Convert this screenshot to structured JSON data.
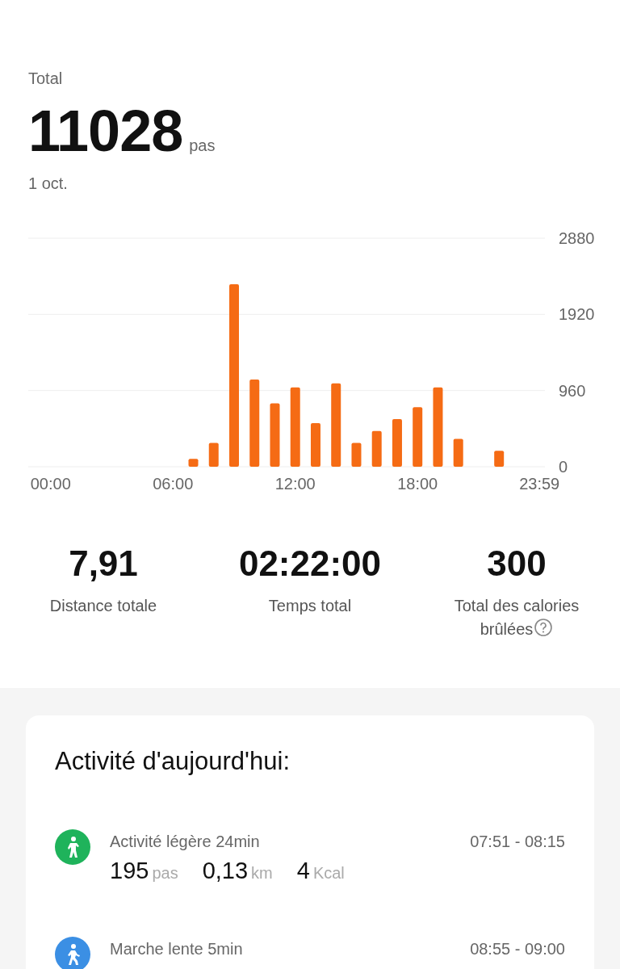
{
  "summary": {
    "label": "Total",
    "steps": "11028",
    "unit": "pas",
    "date": "1 oct."
  },
  "chart_data": {
    "type": "bar",
    "x": [
      7,
      8,
      9,
      10,
      11,
      12,
      13,
      14,
      15,
      16,
      17,
      18,
      19,
      20,
      22
    ],
    "series": [
      {
        "color": "#f56b14",
        "values": [
          100,
          300,
          2300,
          1100,
          800,
          1000,
          550,
          1050,
          300,
          450,
          600,
          750,
          1000,
          350,
          200
        ]
      }
    ],
    "xlim": [
      -1.1,
      24.25
    ],
    "ylim": [
      0,
      2880
    ],
    "yticks": [
      0,
      960,
      1920,
      2880
    ],
    "xticks": [
      {
        "value": 0,
        "label": "00:00"
      },
      {
        "value": 6,
        "label": "06:00"
      },
      {
        "value": 12,
        "label": "12:00"
      },
      {
        "value": 18,
        "label": "18:00"
      },
      {
        "value": 23.98,
        "label": "23:59"
      }
    ]
  },
  "stats": [
    {
      "value": "7,91",
      "label": "Distance totale"
    },
    {
      "value": "02:22:00",
      "label": "Temps total"
    },
    {
      "value": "300",
      "label": "Total des calories brûlées",
      "help": true
    }
  ],
  "activity": {
    "title": "Activité d'aujourd'hui:",
    "items": [
      {
        "kind": "light",
        "color": "#1fb35b",
        "title": "Activité légère 24min",
        "time": "07:51 - 08:15",
        "metrics": [
          {
            "value": "195",
            "unit": "pas"
          },
          {
            "value": "0,13",
            "unit": "km"
          },
          {
            "value": "4",
            "unit": "Kcal"
          }
        ]
      },
      {
        "kind": "walk",
        "color": "#3b8fe4",
        "title": "Marche lente 5min",
        "time": "08:55 - 09:00"
      }
    ]
  }
}
